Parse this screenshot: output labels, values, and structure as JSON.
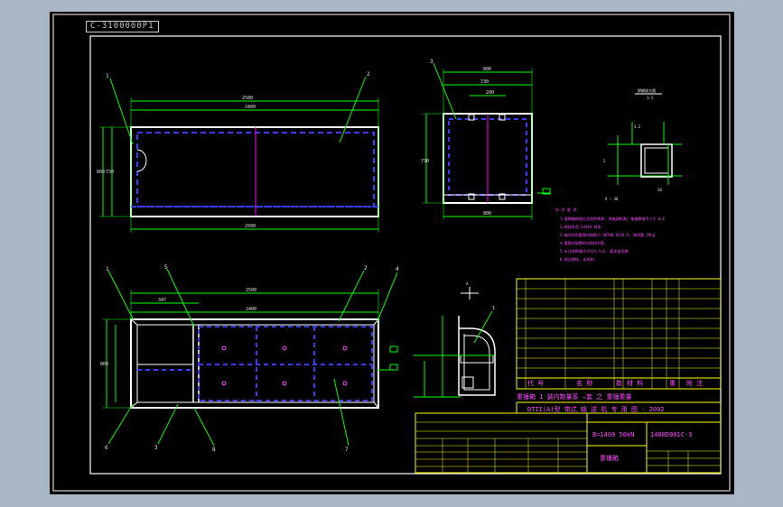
{
  "drawing": {
    "sheet_tag": "C-3100000P1",
    "colors": {
      "background": "#a9b6c4",
      "sheet": "#000000",
      "outline": "#ffffff",
      "dimension": "#00ff00",
      "hidden": "#3b3bff",
      "center": "#ff00ff",
      "note": "#ff4dff",
      "title_border": "#ffff00"
    },
    "title_block": {
      "header_cols": [
        "代 号",
        "名 称",
        "数",
        "材 料",
        "重",
        "附 注"
      ],
      "project": "DTII(A)型  带式 输 送 机 专 用 图 - 2002",
      "spec": "B=1400  50kN",
      "drawing_no": "1400D001C-3",
      "part_name": "重锤箱",
      "subtitle_row": "重锤箱  1 装内数量系  —套 之 重锤重量"
    }
  }
}
